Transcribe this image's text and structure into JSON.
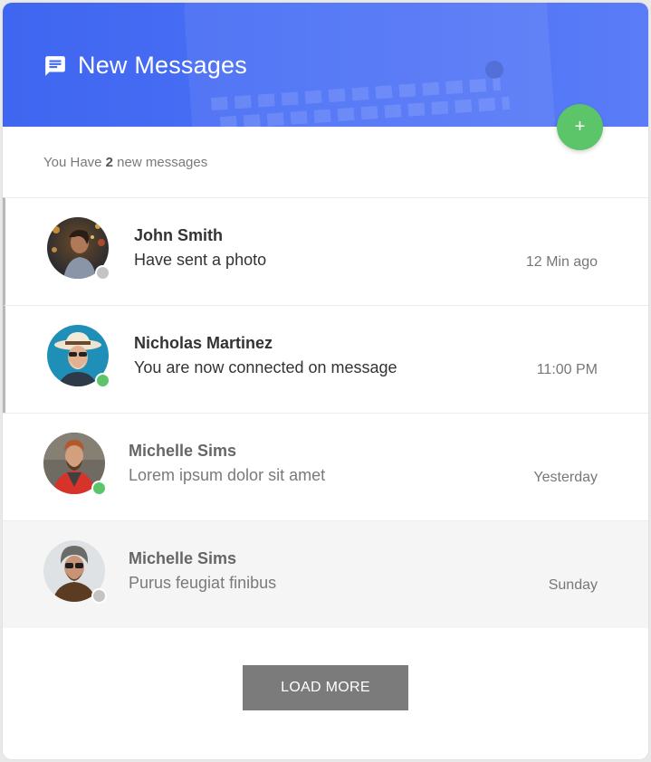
{
  "header": {
    "title": "New Messages",
    "icon": "chat-icon",
    "add_label": "+"
  },
  "summary": {
    "prefix": "You Have ",
    "count": "2",
    "suffix": " new messages"
  },
  "messages": [
    {
      "name": "John Smith",
      "preview": "Have sent a photo",
      "time": "12 Min ago",
      "status": "offline",
      "unread": true
    },
    {
      "name": "Nicholas Martinez",
      "preview": "You are now connected on message",
      "time": "11:00 PM",
      "status": "online",
      "unread": true
    },
    {
      "name": "Michelle Sims",
      "preview": "Lorem ipsum dolor sit amet",
      "time": "Yesterday",
      "status": "online",
      "unread": false
    },
    {
      "name": "Michelle Sims",
      "preview": "Purus feugiat finibus",
      "time": "Sunday",
      "status": "offline",
      "unread": false
    }
  ],
  "footer": {
    "load_more_label": "LOAD MORE"
  },
  "colors": {
    "header_blue": "#4068f2",
    "online_green": "#5cc56a",
    "offline_gray": "#c4c4c4",
    "button_gray": "#7b7b7b"
  }
}
